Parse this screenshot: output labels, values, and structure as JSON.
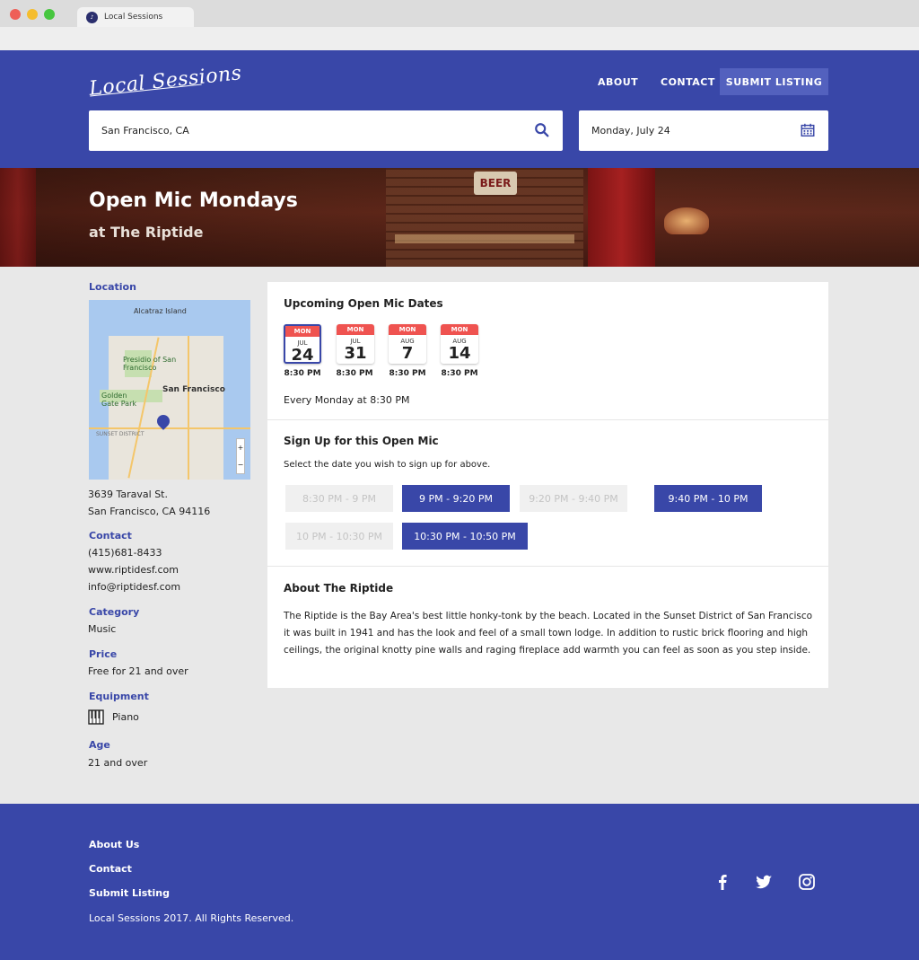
{
  "browser": {
    "tab_title": "Local Sessions"
  },
  "header": {
    "logo": "Local Sessions",
    "nav": {
      "about": "ABOUT",
      "contact": "CONTACT",
      "submit": "SUBMIT LISTING"
    },
    "search": {
      "location": "San Francisco, CA",
      "date": "Monday, July 24"
    }
  },
  "hero": {
    "title": "Open Mic Mondays",
    "subtitle": "at The Riptide",
    "sign_text": "BEER"
  },
  "sidebar": {
    "location_label": "Location",
    "map_labels": {
      "sf": "San Francisco",
      "presidio": "Presidio of San Francisco",
      "golden_gate": "Golden Gate Park",
      "alcatraz": "Alcatraz Island",
      "sunset": "SUNSET DISTRICT"
    },
    "address_line1": "3639 Taraval St.",
    "address_line2": "San Francisco, CA 94116",
    "contact_label": "Contact",
    "phone": "(415)681-8433",
    "website": "www.riptidesf.com",
    "email": "info@riptidesf.com",
    "category_label": "Category",
    "category": "Music",
    "price_label": "Price",
    "price": "Free for 21 and over",
    "equipment_label": "Equipment",
    "equipment": "Piano",
    "age_label": "Age",
    "age": "21 and over"
  },
  "dates": {
    "title": "Upcoming Open Mic Dates",
    "items": [
      {
        "dow": "MON",
        "month": "JUL",
        "day": "24",
        "time": "8:30 PM",
        "selected": true
      },
      {
        "dow": "MON",
        "month": "JUL",
        "day": "31",
        "time": "8:30 PM",
        "selected": false
      },
      {
        "dow": "MON",
        "month": "AUG",
        "day": "7",
        "time": "8:30 PM",
        "selected": false
      },
      {
        "dow": "MON",
        "month": "AUG",
        "day": "14",
        "time": "8:30 PM",
        "selected": false
      }
    ],
    "recurrence": "Every Monday at 8:30 PM"
  },
  "signup": {
    "title": "Sign Up for this Open Mic",
    "description": "Select the date you wish to sign up for above.",
    "slots": [
      {
        "label": "8:30 PM - 9 PM",
        "available": false
      },
      {
        "label": "9 PM - 9:20 PM",
        "available": true
      },
      {
        "label": "9:20 PM - 9:40 PM",
        "available": false
      },
      {
        "label": "9:40 PM - 10 PM",
        "available": true
      },
      {
        "label": "10 PM - 10:30 PM",
        "available": false
      },
      {
        "label": "10:30 PM - 10:50 PM",
        "available": true
      }
    ]
  },
  "about": {
    "title": "About The Riptide",
    "text": "The Riptide is the Bay Area's best little honky-tonk by the beach. Located in the Sunset District of San Francisco it was built in 1941 and has the look and feel of a small town lodge. In addition to rustic brick flooring and high ceilings, the original knotty pine walls and raging fireplace add warmth you can feel as soon as you step inside."
  },
  "footer": {
    "links": [
      "About Us",
      "Contact",
      "Submit Listing"
    ],
    "copyright": "Local Sessions 2017. All Rights Reserved.",
    "social": [
      "facebook-icon",
      "twitter-icon",
      "instagram-icon"
    ]
  },
  "colors": {
    "brand": "#3947a8",
    "accent_red": "#ef5350",
    "slot_taken": "#f0f0f0"
  }
}
